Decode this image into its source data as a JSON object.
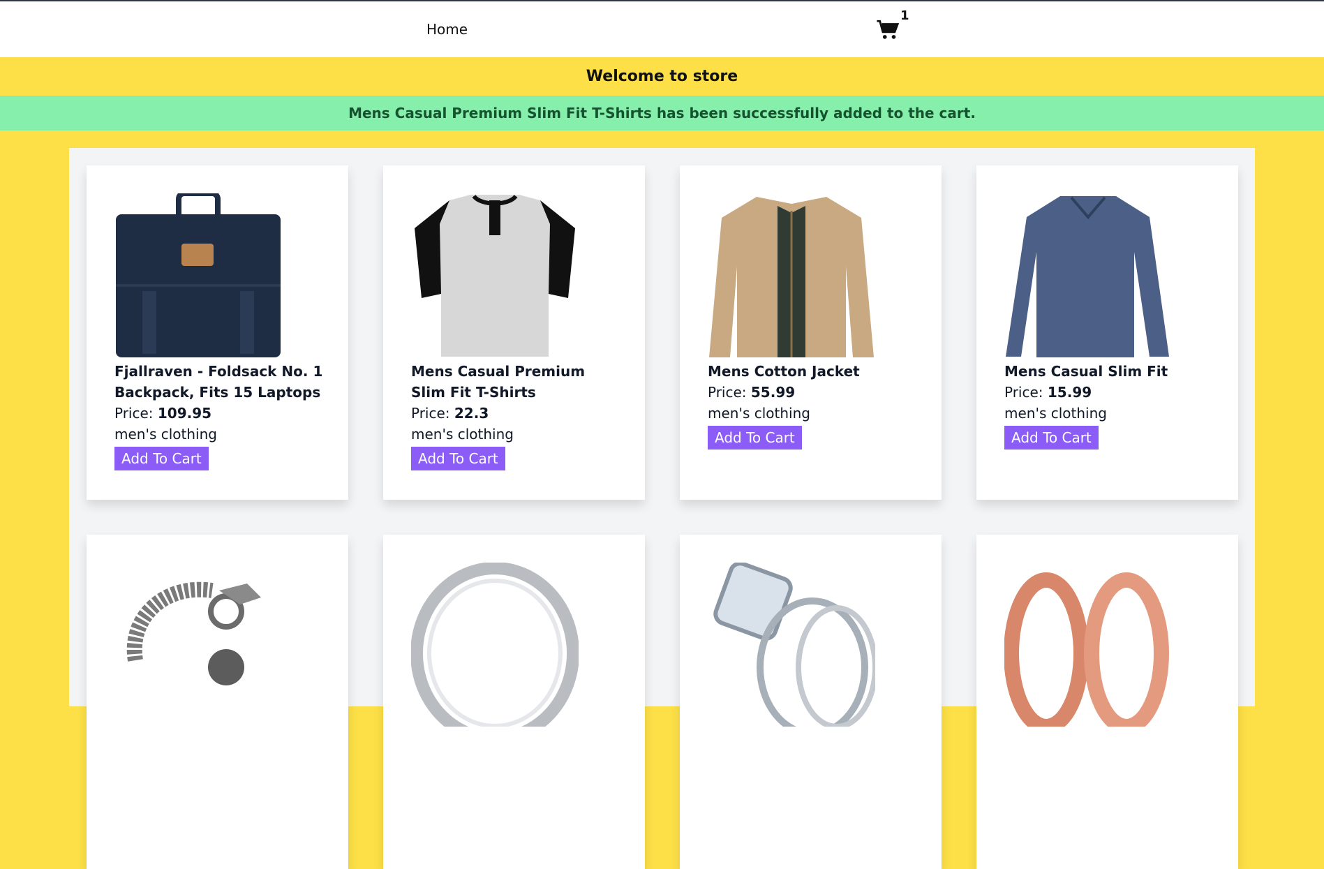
{
  "nav": {
    "home_label": "Home",
    "cart_count": "1"
  },
  "banner": {
    "welcome": "Welcome to store"
  },
  "notice": {
    "message": "Mens Casual Premium Slim Fit T-Shirts has been successfully added to the cart."
  },
  "products": [
    {
      "title": "Fjallraven - Foldsack No. 1 Backpack, Fits 15 Laptops",
      "price_label": "Price: ",
      "price": "109.95",
      "category": "men's clothing",
      "button": "Add To Cart"
    },
    {
      "title": "Mens Casual Premium Slim Fit T-Shirts",
      "price_label": "Price: ",
      "price": "22.3",
      "category": "men's clothing",
      "button": "Add To Cart"
    },
    {
      "title": "Mens Cotton Jacket",
      "price_label": "Price: ",
      "price": "55.99",
      "category": "men's clothing",
      "button": "Add To Cart"
    },
    {
      "title": "Mens Casual Slim Fit",
      "price_label": "Price: ",
      "price": "15.99",
      "category": "men's clothing",
      "button": "Add To Cart"
    }
  ],
  "colors": {
    "background": "#fde047",
    "notice_bg": "#86efac",
    "button": "#8b5cf6"
  }
}
